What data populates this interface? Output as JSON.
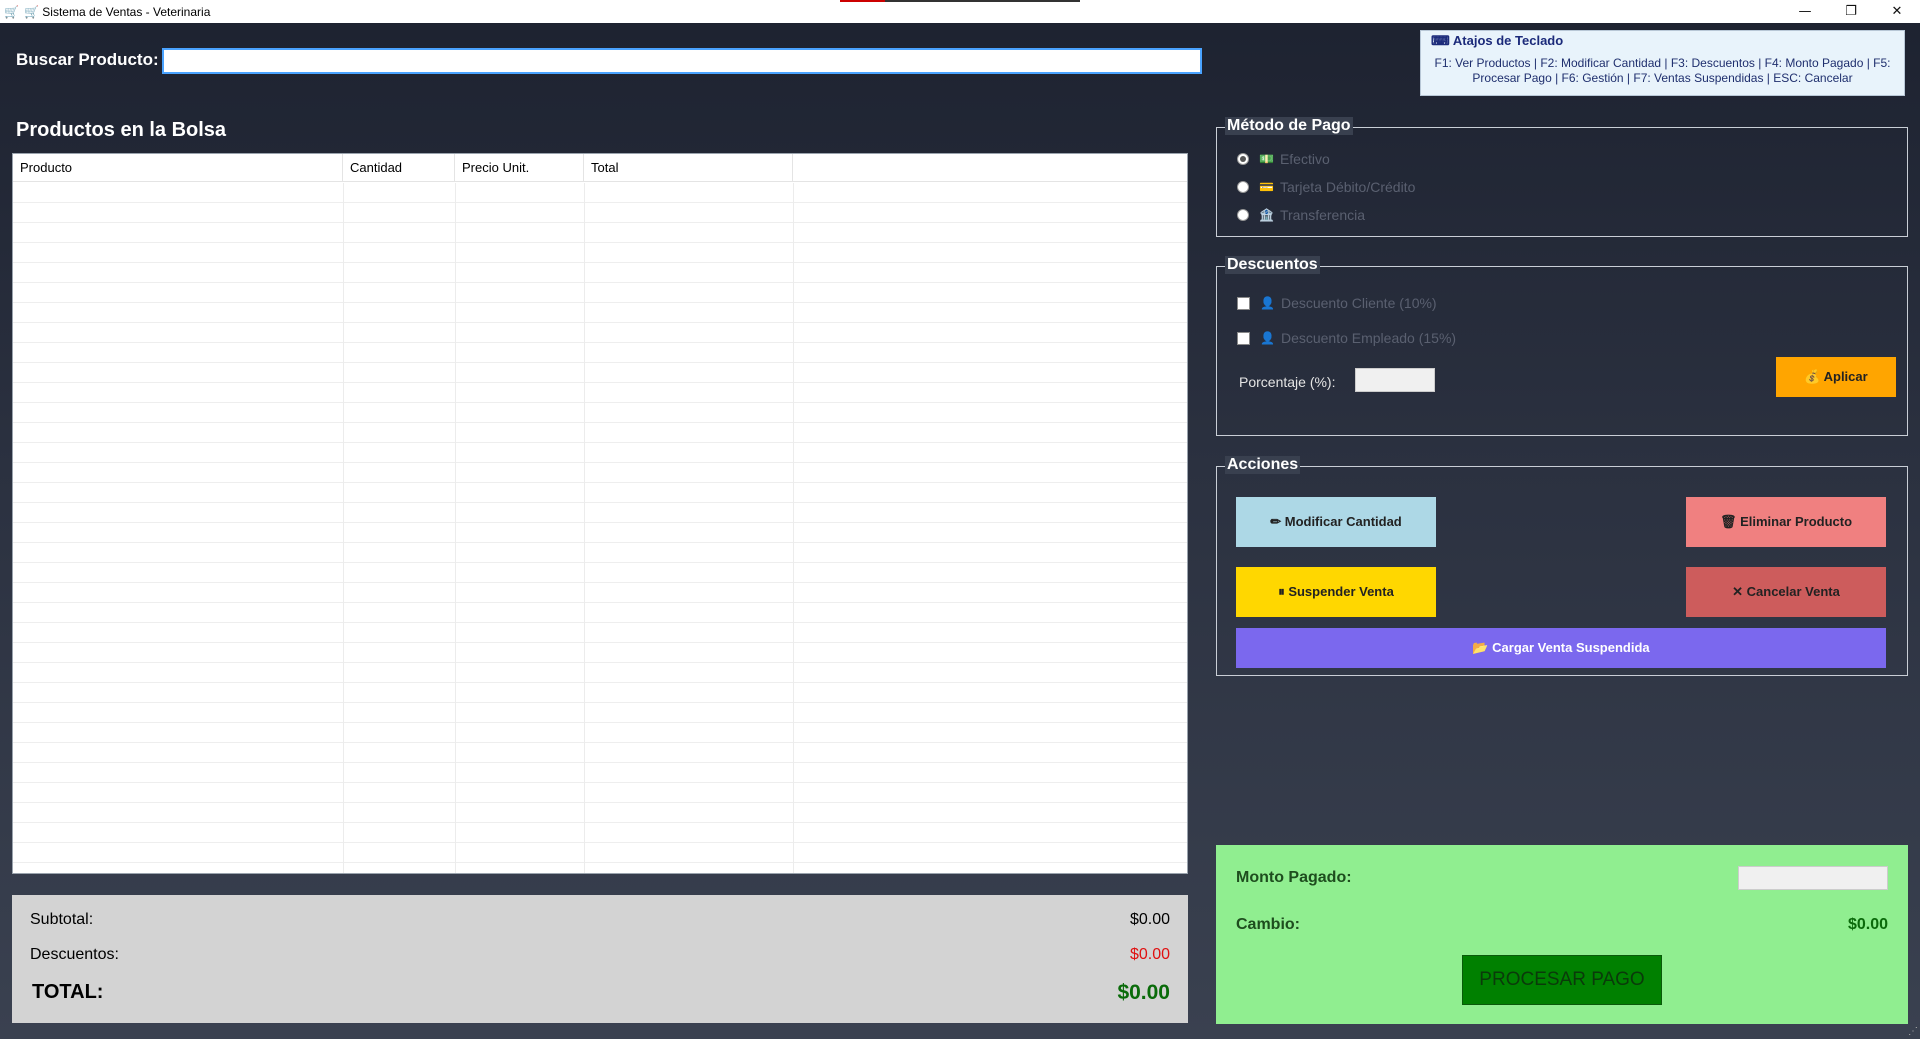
{
  "window": {
    "title": "🛒 Sistema de Ventas - Veterinaria",
    "controls": {
      "minimize": "—",
      "restore": "❐",
      "close": "✕"
    }
  },
  "search": {
    "label": "Buscar Producto:",
    "value": "",
    "placeholder": ""
  },
  "shortcuts": {
    "title": "⌨ Atajos de Teclado",
    "text": "F1: Ver Productos | F2: Modificar Cantidad | F3: Descuentos | F4: Monto Pagado | F5: Procesar Pago | F6: Gestión | F7: Ventas Suspendidas | ESC: Cancelar"
  },
  "products": {
    "title": "Productos en la Bolsa",
    "columns": [
      "Producto",
      "Cantidad",
      "Precio Unit.",
      "Total"
    ],
    "rows": []
  },
  "totals": {
    "subtotal_label": "Subtotal:",
    "subtotal": "$0.00",
    "discounts_label": "Descuentos:",
    "discounts": "$0.00",
    "total_label": "TOTAL:",
    "total": "$0.00"
  },
  "payment_method": {
    "legend": "Método de Pago",
    "options": [
      {
        "icon": "💵",
        "label": "Efectivo",
        "selected": true
      },
      {
        "icon": "💳",
        "label": "Tarjeta Débito/Crédito",
        "selected": false
      },
      {
        "icon": "🏦",
        "label": "Transferencia",
        "selected": false
      }
    ]
  },
  "discounts": {
    "legend": "Descuentos",
    "options": [
      {
        "icon": "👤",
        "label": "Descuento Cliente (10%)",
        "checked": false
      },
      {
        "icon": "👤",
        "label": "Descuento Empleado (15%)",
        "checked": false
      }
    ],
    "percent_label": "Porcentaje (%):",
    "percent_value": "",
    "apply_button": "💰 Aplicar"
  },
  "actions": {
    "legend": "Acciones",
    "modify_qty": "✏ Modificar Cantidad",
    "delete_product": "🗑 Eliminar Producto",
    "suspend_sale": "⏸ Suspender Venta",
    "cancel_sale": "✕ Cancelar Venta",
    "load_suspended": "📂 Cargar Venta Suspendida"
  },
  "payment": {
    "paid_label": "Monto Pagado:",
    "paid_value": "",
    "change_label": "Cambio:",
    "change_value": "$0.00",
    "process_button": "PROCESAR PAGO"
  },
  "colors": {
    "apply": "#ffa500",
    "modify": "#add8e6",
    "delete": "#f08080",
    "suspend": "#ffd700",
    "cancel": "#cd5c5c",
    "load": "#7b68ee",
    "payment_panel": "#90ee90",
    "process": "#008000"
  }
}
